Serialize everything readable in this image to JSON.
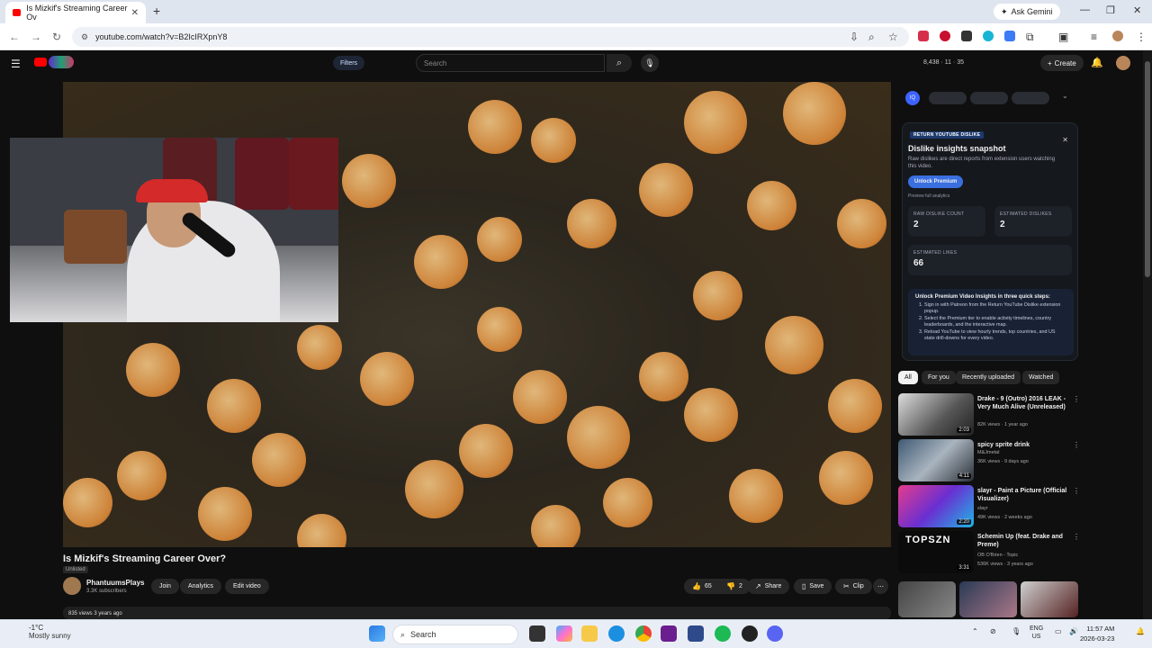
{
  "browser": {
    "tab_title": "Is Mizkif's Streaming Career Ov",
    "new_tab": "+",
    "gemini": "Ask Gemini",
    "url": "youtube.com/watch?v=B2IcIRXpnY8"
  },
  "yt": {
    "filters": "Filters",
    "search_placeholder": "Search",
    "stats": "8,438 · 11 · 35",
    "create": "Create"
  },
  "video": {
    "title": "Is Mizkif's Streaming Career Over?",
    "visibility": "Unlisted",
    "channel": "PhantuumsPlays",
    "subscribers": "3.3K subscribers",
    "join": "Join",
    "analytics": "Analytics",
    "edit": "Edit video",
    "likes": "65",
    "dislikes": "2",
    "share": "Share",
    "save": "Save",
    "clip": "Clip",
    "views": "835 views  3 years ago"
  },
  "ryd": {
    "badge": "RETURN YOUTUBE DISLIKE",
    "title": "Dislike insights snapshot",
    "subtitle": "Raw dislikes are direct reports from extension users watching this video.",
    "unlock": "Unlock Premium",
    "preview": "Preview full analytics",
    "raw_label": "RAW DISLIKE COUNT",
    "raw_value": "2",
    "est_dis_label": "ESTIMATED DISLIKES",
    "est_dis_value": "2",
    "est_likes_label": "ESTIMATED LIKES",
    "est_likes_value": "66",
    "steps_title": "Unlock Premium Video Insights in three quick steps:",
    "steps": [
      "Sign in with Patreon from the Return YouTube Dislike extension popup.",
      "Select the Premium tier to enable activity timelines, country leaderboards, and the interactive map.",
      "Reload YouTube to view hourly trends, top countries, and US state drill-downs for every video."
    ]
  },
  "chips": [
    "All",
    "For you",
    "Recently uploaded",
    "Watched"
  ],
  "recs": [
    {
      "title": "Drake - 9 (Outro) 2016 LEAK - Very Much Alive (Unreleased)",
      "channel": "",
      "meta": "82K views · 1 year ago",
      "duration": "2:03"
    },
    {
      "title": "spicy sprite drink",
      "channel": "M&Jmetal",
      "meta": "36K views · 9 days ago",
      "duration": "4:11"
    },
    {
      "title": "slayr - Paint a Picture (Official Visualizer)",
      "channel": "slayr",
      "meta": "49K views · 2 weeks ago",
      "duration": "2:20"
    },
    {
      "title": "Schemin Up (feat. Drake and Preme)",
      "channel": "OB O'Brien - Topic",
      "meta": "536K views · 3 years ago",
      "duration": "3:31"
    }
  ],
  "taskbar": {
    "temp": "-1°C",
    "weather": "Mostly sunny",
    "search": "Search",
    "lang1": "ENG",
    "lang2": "US",
    "time": "11:57 AM",
    "date": "2026-03-23"
  }
}
